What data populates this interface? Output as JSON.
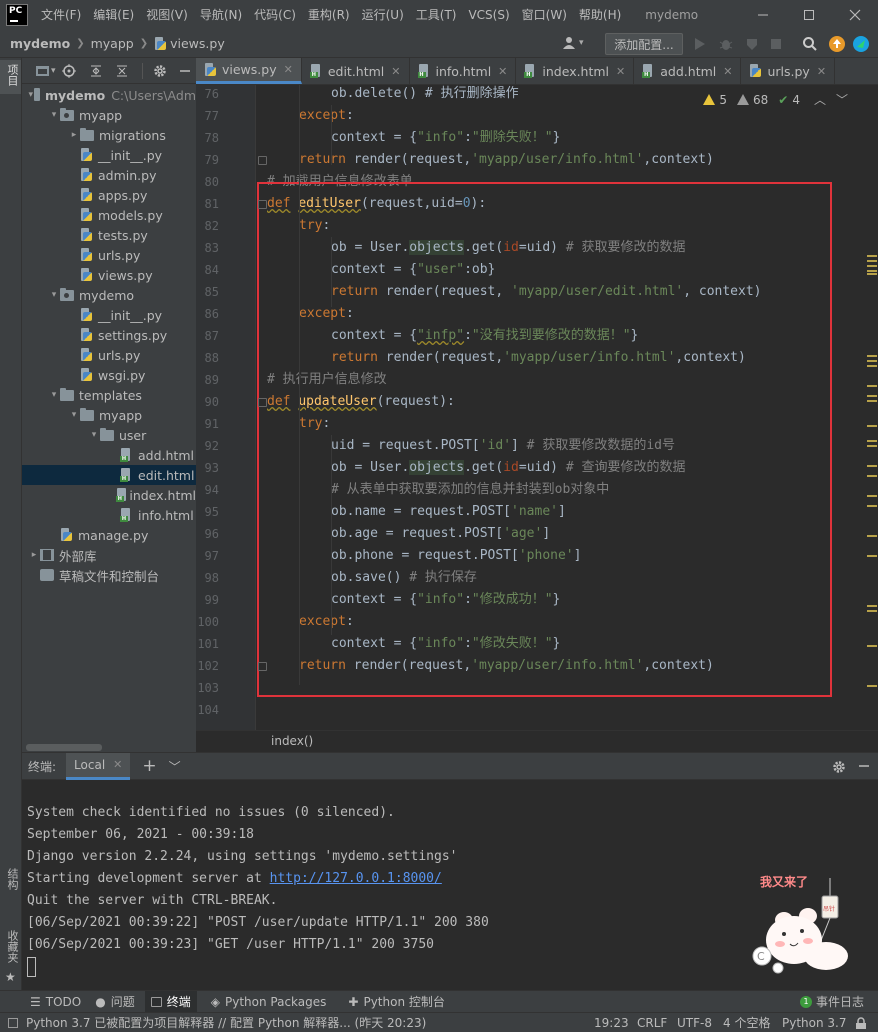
{
  "menubar": {
    "logo": "PC",
    "items": [
      "文件(F)",
      "编辑(E)",
      "视图(V)",
      "导航(N)",
      "代码(C)",
      "重构(R)",
      "运行(U)",
      "工具(T)",
      "VCS(S)",
      "窗口(W)",
      "帮助(H)"
    ],
    "window_title": "mydemo"
  },
  "navbar": {
    "breadcrumb": [
      "mydemo",
      "myapp",
      "views.py"
    ],
    "config_button": "添加配置..."
  },
  "left_strip": {
    "project_label": "项目",
    "structure_label": "结构",
    "favorites_label": "收藏夹"
  },
  "project_tree": [
    {
      "label": "mydemo",
      "extra": "C:\\Users\\Adm",
      "type": "folder",
      "depth": 0,
      "expanded": true
    },
    {
      "label": "myapp",
      "type": "folder",
      "depth": 1,
      "expanded": true
    },
    {
      "label": "migrations",
      "type": "folder",
      "depth": 2,
      "expanded": false
    },
    {
      "label": "__init__.py",
      "type": "py",
      "depth": 2
    },
    {
      "label": "admin.py",
      "type": "py",
      "depth": 2
    },
    {
      "label": "apps.py",
      "type": "py",
      "depth": 2
    },
    {
      "label": "models.py",
      "type": "py",
      "depth": 2
    },
    {
      "label": "tests.py",
      "type": "py",
      "depth": 2
    },
    {
      "label": "urls.py",
      "type": "py",
      "depth": 2
    },
    {
      "label": "views.py",
      "type": "py",
      "depth": 2
    },
    {
      "label": "mydemo",
      "type": "folder",
      "depth": 1,
      "expanded": true
    },
    {
      "label": "__init__.py",
      "type": "py",
      "depth": 2
    },
    {
      "label": "settings.py",
      "type": "py",
      "depth": 2
    },
    {
      "label": "urls.py",
      "type": "py",
      "depth": 2
    },
    {
      "label": "wsgi.py",
      "type": "py",
      "depth": 2
    },
    {
      "label": "templates",
      "type": "folder",
      "depth": 1,
      "expanded": true
    },
    {
      "label": "myapp",
      "type": "folder",
      "depth": 2,
      "expanded": true
    },
    {
      "label": "user",
      "type": "folder",
      "depth": 3,
      "expanded": true
    },
    {
      "label": "add.html",
      "type": "html",
      "depth": 4
    },
    {
      "label": "edit.html",
      "type": "html",
      "depth": 4,
      "selected": true
    },
    {
      "label": "index.html",
      "type": "html",
      "depth": 4
    },
    {
      "label": "info.html",
      "type": "html",
      "depth": 4
    },
    {
      "label": "manage.py",
      "type": "py",
      "depth": 1
    },
    {
      "label": "外部库",
      "type": "lib",
      "depth": 0,
      "expanded": false
    },
    {
      "label": "草稿文件和控制台",
      "type": "scratch",
      "depth": 0
    }
  ],
  "tabs": [
    {
      "label": "views.py",
      "type": "py",
      "active": true
    },
    {
      "label": "edit.html",
      "type": "html"
    },
    {
      "label": "info.html",
      "type": "html"
    },
    {
      "label": "index.html",
      "type": "html"
    },
    {
      "label": "add.html",
      "type": "html"
    },
    {
      "label": "urls.py",
      "type": "py"
    }
  ],
  "inspections": {
    "warnings": "5",
    "weak_warnings": "68",
    "typos": "4"
  },
  "code": {
    "line_numbers": [
      "76",
      "77",
      "78",
      "79",
      "80",
      "81",
      "82",
      "83",
      "84",
      "85",
      "86",
      "87",
      "88",
      "89",
      "90",
      "91",
      "92",
      "93",
      "94",
      "95",
      "96",
      "97",
      "98",
      "99",
      "100",
      "101",
      "102",
      "103",
      "104"
    ],
    "l76": "ob.delete() # 执行删除操作",
    "l77_kw": "except",
    "l78_a": "context = {",
    "l78_s": "\"info\"",
    "l78_b": ":",
    "l78_s2": "\"删除失败！\"",
    "l78_c": "}",
    "l79_kw": "return",
    "l79_a": " render(request,",
    "l79_s": "'myapp/user/info.html'",
    "l79_b": ",context)",
    "l80": "# 加载用户信息修改表单",
    "l81_kw": "def",
    "l81_fn": "editUser",
    "l81_a": "(request,uid=",
    "l81_n": "0",
    "l81_b": "):",
    "l82_kw": "try",
    "l83_a": "ob = User.",
    "l83_o": "objects",
    "l83_b": ".get(",
    "l83_p": "id",
    "l83_c": "=uid)",
    "l83_cm": " # 获取要修改的数据",
    "l84_a": "context = {",
    "l84_s": "\"user\"",
    "l84_b": ":ob}",
    "l85_kw": "return",
    "l85_a": " render(request, ",
    "l85_s": "'myapp/user/edit.html'",
    "l85_b": ", context)",
    "l86_kw": "except",
    "l87_a": "context = {",
    "l87_s": "\"infp\"",
    "l87_b": ":",
    "l87_s2": "\"没有找到要修改的数据！\"",
    "l87_c": "}",
    "l88_kw": "return",
    "l88_a": " render(request,",
    "l88_s": "'myapp/user/info.html'",
    "l88_b": ",context)",
    "l89": "# 执行用户信息修改",
    "l90_kw": "def",
    "l90_fn": "updateUser",
    "l90_a": "(request):",
    "l91_kw": "try",
    "l92_a": "uid = request.POST[",
    "l92_s": "'id'",
    "l92_b": "]",
    "l92_cm": " # 获取要修改数据的id号",
    "l93_a": "ob = User.",
    "l93_o": "objects",
    "l93_b": ".get(",
    "l93_p": "id",
    "l93_c": "=uid)",
    "l93_cm": " # 查询要修改的数据",
    "l94": "# 从表单中获取要添加的信息并封装到ob对象中",
    "l95_a": "ob.name = request.POST[",
    "l95_s": "'name'",
    "l95_b": "]",
    "l96_a": "ob.age = request.POST[",
    "l96_s": "'age'",
    "l96_b": "]",
    "l97_a": "ob.phone = request.POST[",
    "l97_s": "'phone'",
    "l97_b": "]",
    "l98_a": "ob.save()",
    "l98_cm": " # 执行保存",
    "l99_a": "context = {",
    "l99_s": "\"info\"",
    "l99_b": ":",
    "l99_s2": "\"修改成功！\"",
    "l99_c": "}",
    "l100_kw": "except",
    "l101_a": "context = {",
    "l101_s": "\"info\"",
    "l101_b": ":",
    "l101_s2": "\"修改失败！\"",
    "l101_c": "}",
    "l102_kw": "return",
    "l102_a": " render(request,",
    "l102_s": "'myapp/user/info.html'",
    "l102_b": ",context)"
  },
  "code_breadcrumb": "index()",
  "terminal": {
    "label": "终端:",
    "tab": "Local",
    "lines": [
      "System check identified no issues (0 silenced).",
      "September 06, 2021 - 00:39:18",
      "Django version 2.2.24, using settings 'mydemo.settings'",
      "Starting development server at ",
      "Quit the server with CTRL-BREAK.",
      "[06/Sep/2021 00:39:22] \"POST /user/update HTTP/1.1\" 200 380",
      "[06/Sep/2021 00:39:23] \"GET /user HTTP/1.1\" 200 3750"
    ],
    "link": "http://127.0.0.1:8000/",
    "mascot_text": "我又来了"
  },
  "tool_windows": [
    {
      "label": "TODO",
      "icon": "list-icon"
    },
    {
      "label": "问题",
      "icon": "problems-icon"
    },
    {
      "label": "终端",
      "icon": "terminal-icon",
      "active": true
    },
    {
      "label": "Python Packages",
      "icon": "packages-icon"
    },
    {
      "label": "Python 控制台",
      "icon": "python-console-icon"
    }
  ],
  "event_log": {
    "count": "1",
    "label": "事件日志"
  },
  "statusbar": {
    "message": "Python 3.7 已被配置为项目解释器 // 配置 Python 解释器... (昨天 20:23)",
    "position": "19:23",
    "line_sep": "CRLF",
    "encoding": "UTF-8",
    "indent": "4 个空格",
    "interpreter": "Python 3.7"
  },
  "colors": {
    "accent": "#4a88c7",
    "highlight_box": "#e0333b",
    "keyword": "#cc7832",
    "string": "#6a8759",
    "function": "#ffc66d",
    "comment": "#808080"
  }
}
